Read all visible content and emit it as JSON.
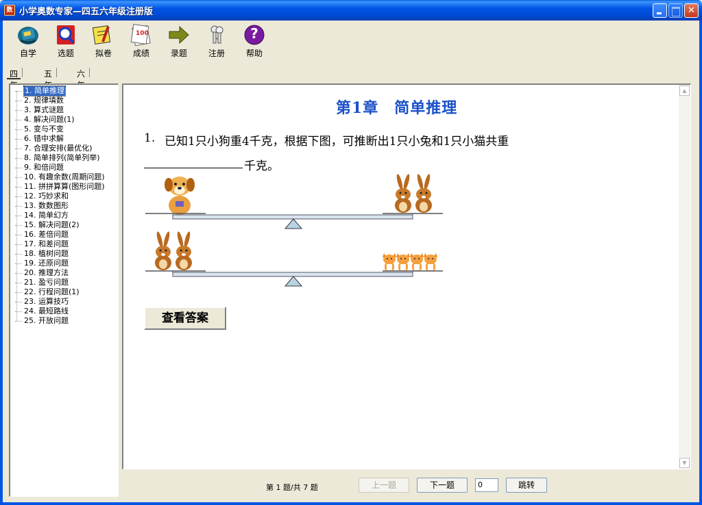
{
  "window": {
    "title": "小学奥数专家—四五六年级注册版",
    "app_icon_glyph": "数"
  },
  "toolbar": {
    "items": [
      {
        "label": "自学",
        "icon": "book-icon"
      },
      {
        "label": "选题",
        "icon": "magnifier-icon"
      },
      {
        "label": "拟卷",
        "icon": "pencil-paper-icon"
      },
      {
        "label": "成绩",
        "icon": "score-paper-icon",
        "badge": "100"
      },
      {
        "label": "录题",
        "icon": "arrow-right-icon"
      },
      {
        "label": "注册",
        "icon": "keys-icon"
      },
      {
        "label": "帮助",
        "icon": "help-icon",
        "glyph": "?"
      }
    ]
  },
  "tabs": [
    {
      "label": "四年级",
      "active": true
    },
    {
      "label": "五年级",
      "active": false
    },
    {
      "label": "六年级",
      "active": false
    }
  ],
  "tree": {
    "items": [
      "1. 简单推理",
      "2. 规律填数",
      "3. 算式谜题",
      "4. 解决问题(1)",
      "5. 变与不变",
      "6. 错中求解",
      "7. 合理安排(最优化)",
      "8. 简单排列(简单列举)",
      "9. 和倍问题",
      "10. 有趣余数(周期问题)",
      "11. 拼拼算算(图形问题)",
      "12. 巧妙求和",
      "13. 数数图形",
      "14. 简单幻方",
      "15. 解决问题(2)",
      "16. 差倍问题",
      "17. 和差问题",
      "18. 植树问题",
      "19. 还原问题",
      "20. 推理方法",
      "21. 盈亏问题",
      "22. 行程问题(1)",
      "23. 运算技巧",
      "24. 最短路线",
      "25. 开放问题"
    ],
    "selected_index": 0
  },
  "content": {
    "chapter_title": "第1章　简单推理",
    "question_number": "1.",
    "question_text": "已知1只小狗重4千克，根据下图，可推断出1只小兔和1只小猫共重",
    "unit": "千克。",
    "answer_button": "查看答案",
    "scale1": {
      "left": "dog-icon",
      "left_count": 1,
      "right": "rabbit-icon",
      "right_count": 2
    },
    "scale2": {
      "left": "rabbit-icon",
      "left_count": 2,
      "right": "cat-icon",
      "right_count": 4
    }
  },
  "navigation": {
    "status": "第 1 题/共 7 题",
    "prev_label": "上一题",
    "next_label": "下一题",
    "jump_value": "0",
    "jump_label": "跳转"
  },
  "colors": {
    "titlebar": "#0055e5",
    "chapter_title": "#1a50c8",
    "selection": "#316ac5",
    "background": "#ece9d8"
  }
}
